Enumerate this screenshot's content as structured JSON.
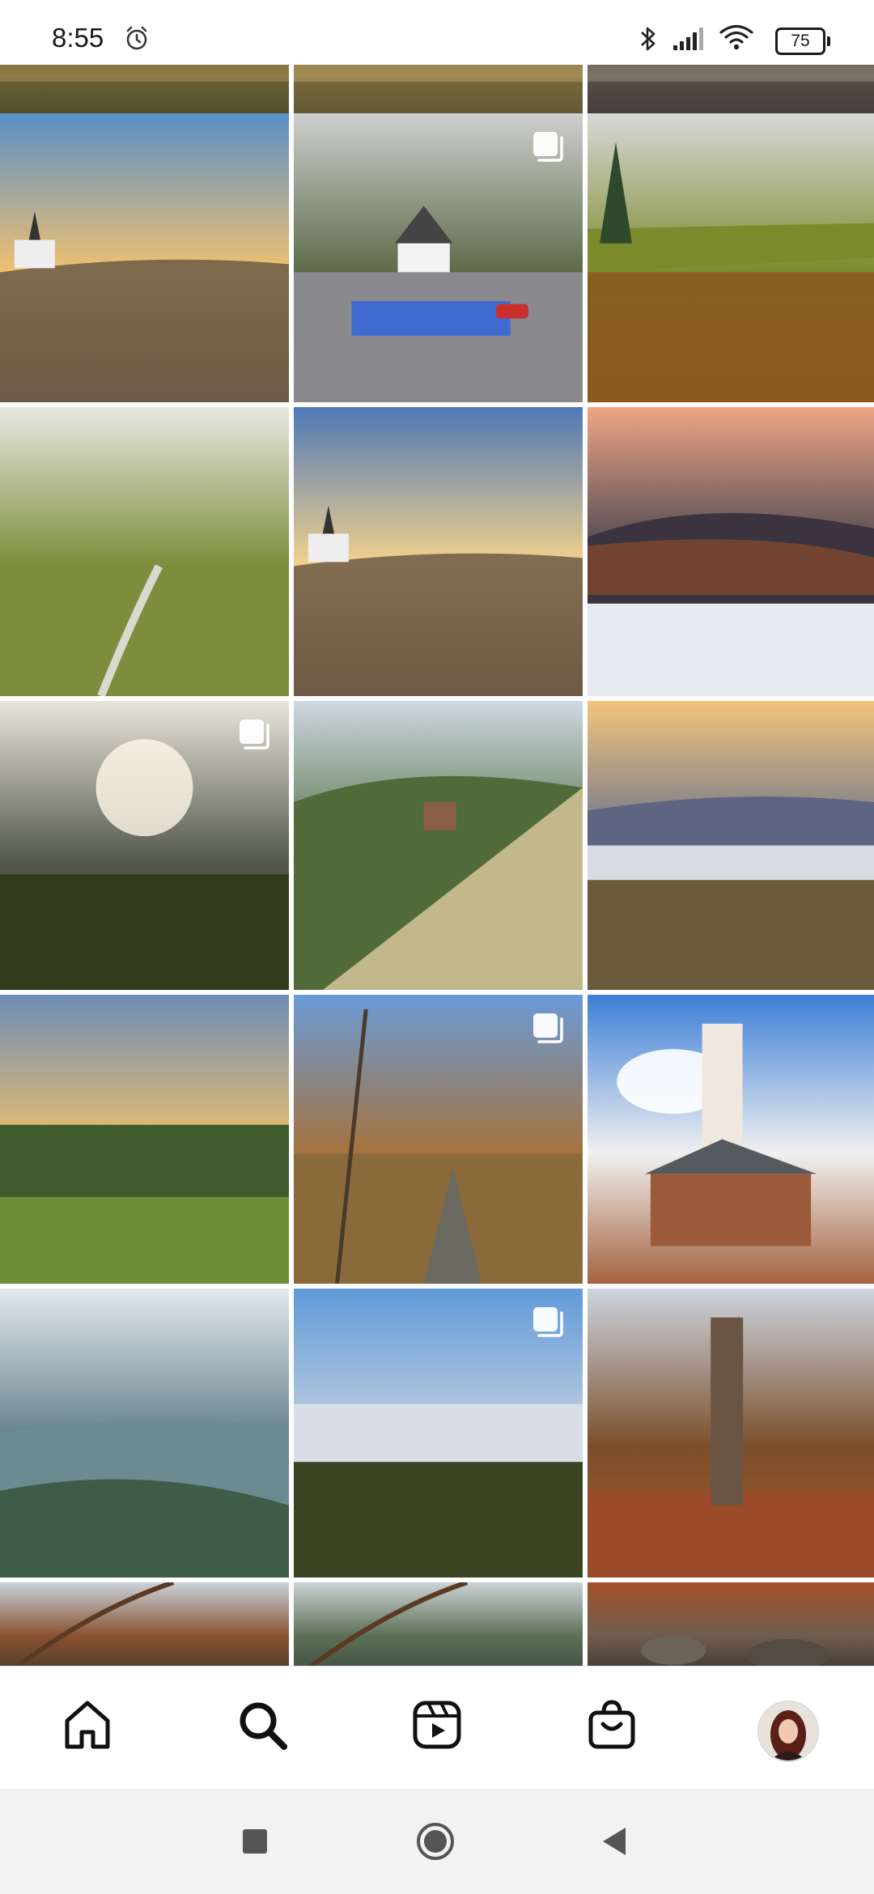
{
  "status_bar": {
    "time": "8:55",
    "battery": "75",
    "icons": [
      "alarm-icon",
      "bluetooth-icon",
      "signal-icon",
      "wifi-icon",
      "battery-icon"
    ]
  },
  "grid": {
    "tiles": [
      {
        "name": "photo-top-partial-1",
        "colors": [
          "#6b6a3a",
          "#8f7a44",
          "#4f4d2c"
        ],
        "type": "landscape"
      },
      {
        "name": "photo-top-partial-2",
        "colors": [
          "#7d6d3b",
          "#a08c53",
          "#5c5431"
        ],
        "type": "landscape"
      },
      {
        "name": "photo-top-partial-3",
        "colors": [
          "#594c46",
          "#7a7466",
          "#3f3935"
        ],
        "type": "landscape"
      },
      {
        "name": "photo-church-meadow",
        "colors": [
          "#5a8fc7",
          "#f0c070",
          "#6b5a46"
        ],
        "type": "sunset"
      },
      {
        "name": "photo-village-parking",
        "colors": [
          "#cfcfcf",
          "#5d6b48",
          "#7c7c80"
        ],
        "type": "village",
        "multi": true
      },
      {
        "name": "photo-forest-lake",
        "colors": [
          "#d8d8d8",
          "#7d8b2f",
          "#8a5a1e"
        ],
        "type": "lake"
      },
      {
        "name": "photo-field-path",
        "colors": [
          "#e8e8e0",
          "#7d8d3c",
          "#5d6a2a"
        ],
        "type": "field"
      },
      {
        "name": "photo-church-meadow-2",
        "colors": [
          "#4e78b6",
          "#f3d28c",
          "#6d5b45"
        ],
        "type": "sunset"
      },
      {
        "name": "photo-misty-hills-pink",
        "colors": [
          "#f0a585",
          "#3c3f4a",
          "#dfe4ee"
        ],
        "type": "mist"
      },
      {
        "name": "photo-sunrise-valley",
        "colors": [
          "#e9e5da",
          "#55594e",
          "#364122"
        ],
        "type": "glow",
        "multi": true
      },
      {
        "name": "photo-mountain-hut",
        "colors": [
          "#cfd8e2",
          "#4f6b3e",
          "#b5ab82"
        ],
        "type": "hill"
      },
      {
        "name": "photo-town-fog",
        "colors": [
          "#f3c37c",
          "#596a8e",
          "#6b5a3a"
        ],
        "type": "fogtown"
      },
      {
        "name": "photo-town-panorama",
        "colors": [
          "#6e8cb6",
          "#f2c26a",
          "#4d6a34"
        ],
        "type": "panorama"
      },
      {
        "name": "photo-forest-path-tower",
        "colors": [
          "#6a9bd8",
          "#a6723c",
          "#6b5b3a"
        ],
        "type": "trail",
        "multi": true
      },
      {
        "name": "photo-stone-lookout-tower",
        "colors": [
          "#3d7fd8",
          "#f0f0f0",
          "#a4623f"
        ],
        "type": "tower"
      },
      {
        "name": "photo-mountain-ridges",
        "colors": [
          "#e2e8ee",
          "#5d7a84",
          "#2c4a32"
        ],
        "type": "ridges"
      },
      {
        "name": "photo-sea-of-clouds",
        "colors": [
          "#5f9ad8",
          "#cbd3e0",
          "#384522"
        ],
        "type": "clouds",
        "multi": true
      },
      {
        "name": "photo-autumn-tower",
        "colors": [
          "#cdd5df",
          "#7b4e2a",
          "#a85a33"
        ],
        "type": "autumntower"
      },
      {
        "name": "photo-bottom-partial-1",
        "colors": [
          "#c8d3dc",
          "#8b5130",
          "#3f3a2e"
        ],
        "type": "branches"
      },
      {
        "name": "photo-bottom-partial-2",
        "colors": [
          "#cbd3d5",
          "#5e6f56",
          "#3b4b43"
        ],
        "type": "branches"
      },
      {
        "name": "photo-bottom-partial-3",
        "colors": [
          "#a3512a",
          "#6f5d4e",
          "#3a332d"
        ],
        "type": "rocks"
      }
    ]
  },
  "bottom_nav": {
    "items": [
      {
        "name": "home-icon"
      },
      {
        "name": "search-icon"
      },
      {
        "name": "reels-icon"
      },
      {
        "name": "shop-icon"
      },
      {
        "name": "profile-avatar"
      }
    ]
  },
  "system_nav": [
    "recents-icon",
    "home-circle-icon",
    "back-icon"
  ]
}
